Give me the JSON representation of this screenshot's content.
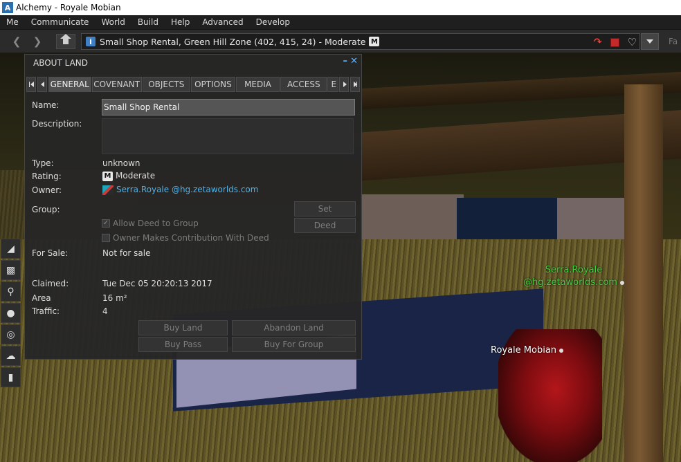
{
  "window": {
    "title": "Alchemy - Royale Mobian"
  },
  "menubar": {
    "items": [
      "Me",
      "Communicate",
      "World",
      "Build",
      "Help",
      "Advanced",
      "Develop"
    ]
  },
  "navbar": {
    "location": "Small Shop Rental, Green Hill Zone (402, 415, 24) - Moderate",
    "rating_badge": "M",
    "favorites_label": "Fa"
  },
  "about_land": {
    "title": "ABOUT LAND",
    "tabs": [
      "GENERAL",
      "COVENANT",
      "OBJECTS",
      "OPTIONS",
      "MEDIA",
      "ACCESS",
      "E"
    ],
    "active_tab": "GENERAL",
    "fields": {
      "name_label": "Name:",
      "name_value": "Small Shop Rental",
      "description_label": "Description:",
      "description_value": "",
      "type_label": "Type:",
      "type_value": "unknown",
      "rating_label": "Rating:",
      "rating_badge": "M",
      "rating_value": "Moderate",
      "owner_label": "Owner:",
      "owner_value": "Serra.Royale @hg.zetaworlds.com",
      "group_label": "Group:",
      "for_sale_label": "For Sale:",
      "for_sale_value": "Not for sale",
      "claimed_label": "Claimed:",
      "claimed_value": "Tue Dec 05 20:20:13 2017",
      "area_label": "Area",
      "area_value": "16 m²",
      "traffic_label": "Traffic:",
      "traffic_value": "4"
    },
    "checkboxes": {
      "allow_deed": "Allow Deed to Group",
      "owner_contribution": "Owner Makes Contribution With Deed"
    },
    "buttons": {
      "set": "Set",
      "deed": "Deed",
      "buy_land": "Buy Land",
      "abandon_land": "Abandon Land",
      "buy_pass": "Buy Pass",
      "buy_for_group": "Buy For Group"
    }
  },
  "scene": {
    "nametag_1_line1": "Serra.Royale",
    "nametag_1_line2": "@hg.zetaworlds.com",
    "nametag_2": "Royale Mobian"
  }
}
